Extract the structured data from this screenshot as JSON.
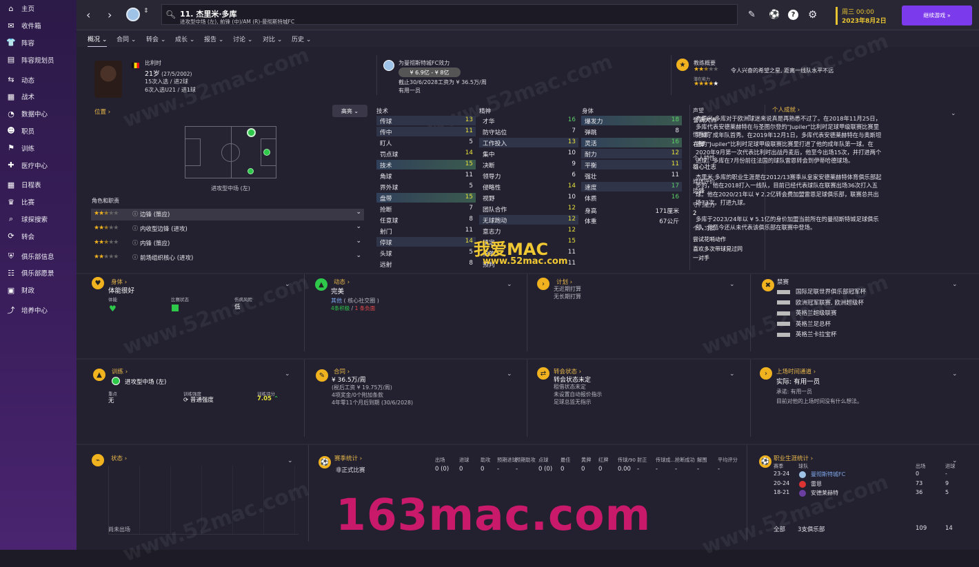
{
  "sidebar": {
    "items": [
      {
        "icon": "home-icon",
        "label": "主页"
      },
      {
        "icon": "inbox-icon",
        "label": "收件箱"
      },
      {
        "icon": "squad-icon",
        "label": "阵容"
      },
      {
        "icon": "squad-planner-icon",
        "label": "阵容规划员"
      },
      {
        "icon": "dynamics-icon",
        "label": "动态"
      },
      {
        "icon": "tactics-icon",
        "label": "战术"
      },
      {
        "icon": "data-hub-icon",
        "label": "数据中心"
      },
      {
        "icon": "staff-icon",
        "label": "职员"
      },
      {
        "icon": "training-icon",
        "label": "训练"
      },
      {
        "icon": "medical-icon",
        "label": "医疗中心"
      },
      {
        "icon": "schedule-icon",
        "label": "日程表"
      },
      {
        "icon": "competitions-icon",
        "label": "比赛"
      },
      {
        "icon": "scouting-icon",
        "label": "球探搜索"
      },
      {
        "icon": "transfers-icon",
        "label": "转会"
      },
      {
        "icon": "club-info-icon",
        "label": "俱乐部信息"
      },
      {
        "icon": "club-vision-icon",
        "label": "俱乐部愿景"
      },
      {
        "icon": "finances-icon",
        "label": "财政"
      },
      {
        "icon": "development-icon",
        "label": "培养中心"
      }
    ]
  },
  "topbar": {
    "player_title": "11. 杰里米·多库",
    "player_sub": "进攻型中场 (左), 前锋 (中)/AM (R)-曼彻斯特城FC",
    "date_line1": "周三 00:00",
    "date_line2": "2023年8月2日",
    "continue_label": "继续游戏 »"
  },
  "tabs": [
    "概况",
    "合同",
    "转会",
    "成长",
    "报告",
    "讨论",
    "对比",
    "历史"
  ],
  "header": {
    "nationality": "比利时",
    "age": "21岁",
    "dob": "(27/5/2002)",
    "caps1": "15次入选 / 进2球",
    "caps2": "6次入选U21 / 进1球",
    "club_line": "为曼彻斯特城FC效力",
    "value": "¥ 6.9亿 - ¥ 8亿",
    "contract": "截止30/6/2028工资为 ¥ 36.5万/周",
    "squad_status": "有用一员",
    "coach_title": "教练概要",
    "coach_text": "令人兴奋的希望之星, 距离一线队水平不远",
    "potential_label": "潜在能力"
  },
  "position": {
    "title": "位置",
    "highlight": "高亮",
    "pos_label": "进攻型中场 (左)",
    "roles_title": "角色和职责",
    "roles": [
      {
        "stars": "★★",
        "half": "★",
        "off": "★★",
        "name": "边锋 (策应)"
      },
      {
        "stars": "★★",
        "half": "★",
        "off": "★★",
        "name": "内收型边锋 (进攻)"
      },
      {
        "stars": "★★",
        "half": "★",
        "off": "★★",
        "name": "内锋 (策应)"
      },
      {
        "stars": "★★",
        "half": "",
        "off": "★★★",
        "name": "前场组织核心 (进攻)"
      }
    ]
  },
  "attributes": {
    "technical_title": "技术",
    "mental_title": "精神",
    "physical_title": "身体",
    "technical": [
      [
        "传球",
        "13",
        "yb"
      ],
      [
        "传中",
        "11",
        "yb"
      ],
      [
        "盯人",
        "5",
        "n"
      ],
      [
        "罚点球",
        "14",
        "y"
      ],
      [
        "技术",
        "15",
        "yg"
      ],
      [
        "角球",
        "11",
        "n"
      ],
      [
        "界外球",
        "5",
        "n"
      ],
      [
        "盘带",
        "15",
        "yg"
      ],
      [
        "抢断",
        "7",
        "n"
      ],
      [
        "任意球",
        "8",
        "n"
      ],
      [
        "射门",
        "11",
        "n"
      ],
      [
        "停球",
        "14",
        "yb"
      ],
      [
        "头球",
        "5",
        "n"
      ],
      [
        "远射",
        "8",
        "n"
      ]
    ],
    "mental": [
      [
        "才华",
        "16",
        "g"
      ],
      [
        "防守站位",
        "7",
        "n"
      ],
      [
        "工作投入",
        "13",
        "yb"
      ],
      [
        "集中",
        "10",
        "n"
      ],
      [
        "决断",
        "9",
        "n"
      ],
      [
        "领导力",
        "6",
        "n"
      ],
      [
        "侵略性",
        "14",
        "y"
      ],
      [
        "视野",
        "10",
        "n"
      ],
      [
        "团队合作",
        "12",
        "y"
      ],
      [
        "无球跑动",
        "12",
        "yb"
      ],
      [
        "意志力",
        "12",
        "y"
      ],
      [
        "镇定",
        "15",
        "y"
      ],
      [
        "勇敢",
        "11",
        "n"
      ],
      [
        "预判",
        "11",
        "n"
      ]
    ],
    "physical": [
      [
        "爆发力",
        "18",
        "gg"
      ],
      [
        "弹跳",
        "8",
        "n"
      ],
      [
        "灵活",
        "16",
        "gg"
      ],
      [
        "耐力",
        "12",
        "yb"
      ],
      [
        "平衡",
        "11",
        "yb"
      ],
      [
        "强壮",
        "11",
        "n"
      ],
      [
        "速度",
        "17",
        "gb"
      ],
      [
        "体质",
        "16",
        "g"
      ]
    ],
    "height_label": "身高",
    "height": "171厘米",
    "weight_label": "体重",
    "weight": "67公斤"
  },
  "side": {
    "rep_label": "声望",
    "rep": "誉满大洲",
    "foot_label": "惯用脚",
    "foot": "右脚",
    "trait_label": "个人特性",
    "trait": "雄心壮志",
    "media_label": "媒体评价",
    "media": "边锋",
    "def_label": "守门能力",
    "def": "2",
    "habit_label": "个人习惯",
    "habits": [
      "尝试花哨动作",
      "喜欢多次带球晃过同",
      "一对手"
    ]
  },
  "bio": {
    "title": "个人成就",
    "paragraphs": [
      "杰里米·多库对于欧洲球迷来说真是再熟悉不过了。在2018年11月25日，多库代表安德莱赫特在与圣图尔登的\"Jupiler\"比利时足球甲级联赛比赛里完成了成年队首秀。在2019年12月1日，多库代表安德莱赫特在与奥斯坦德的\"Jupiler\"比利时足球甲级联赛比赛里打进了他的成年队第一球。在2020年9月第一次代表比利时出战丹麦后，他至今出场15次，并打进两个进球。多库在7月份前往法国的球队雷恩转会到伊蒂哈德球场。",
      "杰里米·多库的职业生涯是在2012/13赛季从皇家安德莱赫特体育俱乐部起步的，他在2018打入一线队，目前已经代表球队在联赛出场36次打入五球。他在2020/21年以 ¥ 2.2亿转会费加盟雷恩足球俱乐部，联赛总共出场73次，打进九球。",
      "多库于2023/24年以 ¥ 5.1亿的身价加盟当前所在的曼彻斯特城足球俱乐部，但至今还从未代表该俱乐部在联赛中登场。"
    ]
  },
  "cards": {
    "body": {
      "title": "身体",
      "value": "体能很好",
      "l1": "体能",
      "l2": "比赛状态",
      "l3": "伤病风险",
      "v3": "低"
    },
    "dynamics": {
      "title": "动态",
      "value": "完美",
      "line1a": "其他",
      "line1b": "( 核心社交圈 )",
      "pos": "4条积极",
      "slash": "/",
      "neg": "1 条负面"
    },
    "plans": {
      "title": "计划",
      "l1": "无近期打算",
      "l2": "无长期打算"
    },
    "bans": {
      "title": "禁赛",
      "items": [
        "国际足联世界俱乐部冠军杯",
        "欧洲冠军联赛, 欧洲超级杯",
        "英格兰超级联赛",
        "英格兰足总杯",
        "英格兰卡拉宝杯"
      ]
    },
    "training": {
      "title": "训练",
      "value": "进攻型中场 (左)",
      "focus_label": "重点",
      "focus": "无",
      "int_label": "训练强度",
      "int": "普通强度",
      "rating_label": "训练评分",
      "rating": "7.05"
    },
    "contract": {
      "title": "合同",
      "value": "¥ 36.5万/周",
      "l1": "(税后工资 ¥ 19.75万/周)",
      "l2": "4项奖金/0个附加条款",
      "l3": "4年零11个月后到期 (30/6/2028)"
    },
    "transfer": {
      "title": "转会状态",
      "value": "转会状态未定",
      "l1": "租借状态未定",
      "l2": "未设置自动报价指示",
      "l3": "足球总监无指示"
    },
    "playtime": {
      "title": "上场时间通道",
      "value": "实际: 有用一员",
      "l1": "承诺: 有用一员",
      "l2": "目前对他的上场时间没有什么想法。"
    },
    "form": {
      "title": "状态",
      "empty": "尚未出场"
    },
    "season": {
      "title": "赛季统计",
      "cols": [
        "出场",
        "进球",
        "助攻",
        "预期进球",
        "预期助攻",
        "点球",
        "最佳",
        "黄牌",
        "红牌",
        "传球/90",
        "射正",
        "传球成...",
        "抢断成功",
        "解围",
        "平均评分"
      ],
      "row_label": "非正式比赛",
      "row": [
        "0 (0)",
        "0",
        "0",
        "-",
        "-",
        "0 (0)",
        "0",
        "0",
        "0",
        "0.00",
        "-",
        "-",
        "-",
        "-",
        "-"
      ]
    },
    "career": {
      "title": "职业生涯统计",
      "h_season": "赛季",
      "h_team": "球队",
      "h_apps": "出场",
      "h_goals": "进球",
      "rows": [
        [
          "23-24",
          "曼彻斯特城FC",
          "0",
          "-"
        ],
        [
          "20-24",
          "雷恩",
          "73",
          "9"
        ],
        [
          "18-21",
          "安德莱赫特",
          "36",
          "5"
        ]
      ],
      "total_label": "全部",
      "total_clubs": "3支俱乐部",
      "total_apps": "109",
      "total_goals": "14"
    }
  },
  "watermarks": {
    "big": "163mac.com",
    "logo": "我爱MAC",
    "url": "www.52mac.com",
    "diag": "www.52mac.com"
  },
  "colors": {
    "accent": "#7c3aed",
    "gold": "#e8b84a",
    "green": "#2ec84a"
  }
}
